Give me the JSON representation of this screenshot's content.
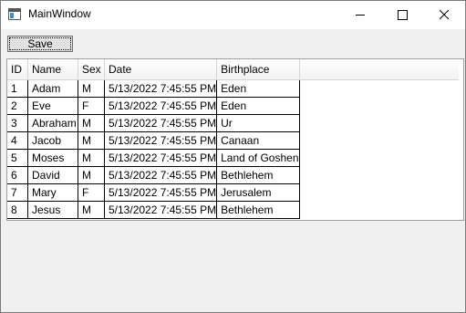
{
  "window": {
    "title": "MainWindow"
  },
  "toolbar": {
    "save_label": "Save"
  },
  "grid": {
    "columns": [
      "ID",
      "Name",
      "Sex",
      "Date",
      "Birthplace"
    ],
    "rows": [
      [
        "1",
        "Adam",
        "M",
        "5/13/2022 7:45:55 PM",
        "Eden"
      ],
      [
        "2",
        "Eve",
        "F",
        "5/13/2022 7:45:55 PM",
        "Eden"
      ],
      [
        "3",
        "Abraham",
        "M",
        "5/13/2022 7:45:55 PM",
        "Ur"
      ],
      [
        "4",
        "Jacob",
        "M",
        "5/13/2022 7:45:55 PM",
        "Canaan"
      ],
      [
        "5",
        "Moses",
        "M",
        "5/13/2022 7:45:55 PM",
        "Land of Goshen"
      ],
      [
        "6",
        "David",
        "M",
        "5/13/2022 7:45:55 PM",
        "Bethlehem"
      ],
      [
        "7",
        "Mary",
        "F",
        "5/13/2022 7:45:55 PM",
        "Jerusalem"
      ],
      [
        "8",
        "Jesus",
        "M",
        "5/13/2022 7:45:55 PM",
        "Bethlehem"
      ]
    ]
  }
}
